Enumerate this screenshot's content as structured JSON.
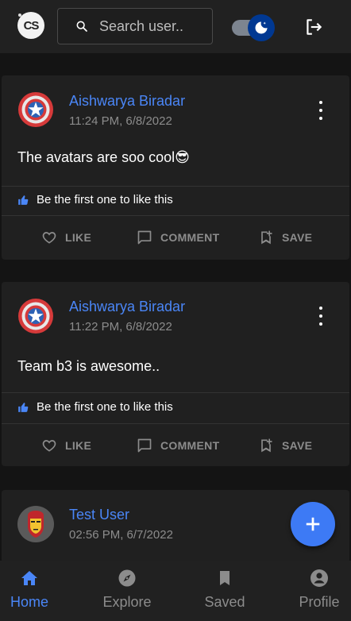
{
  "header": {
    "logo_text": "CS",
    "search": {
      "placeholder": "Search user.."
    },
    "theme_toggle": {
      "state": "dark"
    }
  },
  "posts": [
    {
      "author": "Aishwarya Biradar",
      "timestamp": "11:24 PM, 6/8/2022",
      "content": "The avatars are soo cool😎",
      "likes_text": "Be the first one to like this",
      "avatar": "captain-america-shield"
    },
    {
      "author": "Aishwarya Biradar",
      "timestamp": "11:22 PM, 6/8/2022",
      "content": "Team b3 is awesome..",
      "likes_text": "Be the first one to like this",
      "avatar": "captain-america-shield"
    },
    {
      "author": "Test User",
      "timestamp": "02:56 PM, 6/7/2022",
      "avatar": "iron-man"
    }
  ],
  "actions": {
    "like": "LIKE",
    "comment": "COMMENT",
    "save": "SAVE"
  },
  "nav": [
    {
      "label": "Home",
      "icon": "home-icon",
      "active": true
    },
    {
      "label": "Explore",
      "icon": "compass-icon"
    },
    {
      "label": "Saved",
      "icon": "bookmark-icon"
    },
    {
      "label": "Profile",
      "icon": "profile-icon"
    }
  ],
  "colors": {
    "accent": "#4a86f7",
    "fab": "#3d7af5",
    "toggle_knob": "#003892"
  }
}
